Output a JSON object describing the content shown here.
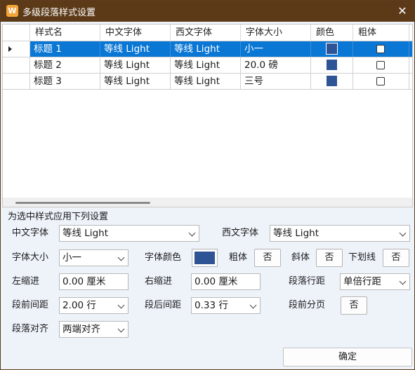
{
  "window": {
    "title": "多级段落样式设置",
    "close_glyph": "✕",
    "app_icon_glyph": "W"
  },
  "grid": {
    "columns": [
      "样式名",
      "中文字体",
      "西文字体",
      "字体大小",
      "颜色",
      "粗体"
    ],
    "rows": [
      {
        "name": "标题 1",
        "cn_font": "等线 Light",
        "en_font": "等线 Light",
        "size": "小一",
        "color": "#2f5496",
        "bold": false,
        "selected": true
      },
      {
        "name": "标题 2",
        "cn_font": "等线 Light",
        "en_font": "等线 Light",
        "size": "20.0 磅",
        "color": "#2f5496",
        "bold": false,
        "selected": false
      },
      {
        "name": "标题 3",
        "cn_font": "等线 Light",
        "en_font": "等线 Light",
        "size": "三号",
        "color": "#2f5496",
        "bold": false,
        "selected": false
      }
    ]
  },
  "settings": {
    "section_title": "为选中样式应用下列设置",
    "cn_font_label": "中文字体",
    "cn_font_value": "等线 Light",
    "en_font_label": "西文字体",
    "en_font_value": "等线 Light",
    "size_label": "字体大小",
    "size_value": "小一",
    "color_label": "字体颜色",
    "color_value": "#2f5496",
    "bold_label": "粗体",
    "bold_value": "否",
    "italic_label": "斜体",
    "italic_value": "否",
    "underline_label": "下划线",
    "underline_value": "否",
    "left_indent_label": "左缩进",
    "left_indent_value": "0.00 厘米",
    "right_indent_label": "右缩进",
    "right_indent_value": "0.00 厘米",
    "line_spacing_label": "段落行距",
    "line_spacing_value": "单倍行距",
    "space_before_label": "段前间距",
    "space_before_value": "2.00 行",
    "space_after_label": "段后间距",
    "space_after_value": "0.33 行",
    "page_break_label": "段前分页",
    "page_break_value": "否",
    "align_label": "段落对齐",
    "align_value": "两端对齐"
  },
  "footer": {
    "ok_label": "确定"
  }
}
